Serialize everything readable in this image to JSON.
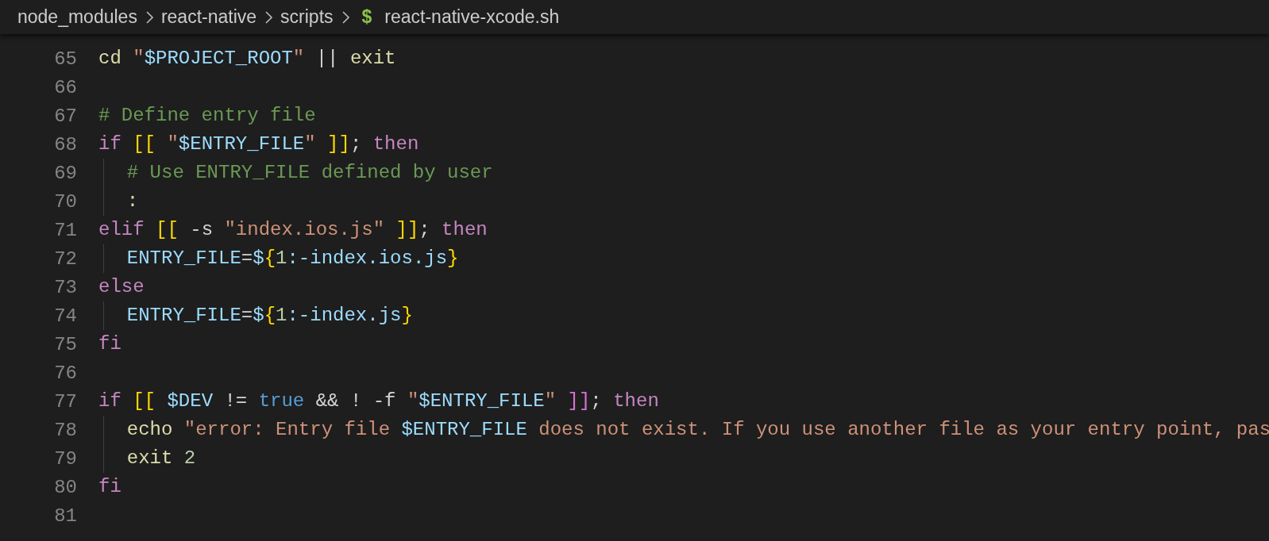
{
  "breadcrumb": [
    {
      "label": "node_modules"
    },
    {
      "label": "react-native"
    },
    {
      "label": "scripts"
    },
    {
      "label": "react-native-xcode.sh",
      "icon": "$"
    }
  ],
  "lines": [
    {
      "number": "65",
      "tokens": [
        {
          "kind": "command",
          "text": "cd"
        },
        {
          "kind": "string",
          "text": " \""
        },
        {
          "kind": "variable",
          "text": "$PROJECT_ROOT"
        },
        {
          "kind": "string",
          "text": "\""
        },
        {
          "kind": "plain",
          "text": " || "
        },
        {
          "kind": "command",
          "text": "exit"
        }
      ]
    },
    {
      "number": "66"
    },
    {
      "number": "67",
      "tokens": [
        {
          "kind": "comment",
          "text": "# Define entry file"
        }
      ]
    },
    {
      "number": "68",
      "tokens": [
        {
          "kind": "keyword",
          "text": "if"
        },
        {
          "kind": "bracket1",
          "text": " [["
        },
        {
          "kind": "string",
          "text": " \""
        },
        {
          "kind": "variable",
          "text": "$ENTRY_FILE"
        },
        {
          "kind": "string",
          "text": "\""
        },
        {
          "kind": "bracket1",
          "text": " ]]"
        },
        {
          "kind": "plain",
          "text": "; "
        },
        {
          "kind": "keyword",
          "text": "then"
        }
      ]
    },
    {
      "number": "69",
      "indented": true,
      "tokens": [
        {
          "kind": "comment",
          "text": "# Use ENTRY_FILE defined by user"
        }
      ]
    },
    {
      "number": "70",
      "indented": true,
      "tokens": [
        {
          "kind": "command",
          "text": ":"
        }
      ]
    },
    {
      "number": "71",
      "tokens": [
        {
          "kind": "keyword",
          "text": "elif"
        },
        {
          "kind": "bracket1",
          "text": " [["
        },
        {
          "kind": "plain",
          "text": " -s "
        },
        {
          "kind": "string",
          "text": "\"index.ios.js\""
        },
        {
          "kind": "bracket1",
          "text": " ]]"
        },
        {
          "kind": "plain",
          "text": "; "
        },
        {
          "kind": "keyword",
          "text": "then"
        }
      ]
    },
    {
      "number": "72",
      "indented": true,
      "tokens": [
        {
          "kind": "variable",
          "text": "ENTRY_FILE"
        },
        {
          "kind": "plain",
          "text": "="
        },
        {
          "kind": "variable",
          "text": "$"
        },
        {
          "kind": "bracket1",
          "text": "{"
        },
        {
          "kind": "number",
          "text": "1"
        },
        {
          "kind": "variable",
          "text": ":-index.ios.js"
        },
        {
          "kind": "bracket1",
          "text": "}"
        }
      ]
    },
    {
      "number": "73",
      "tokens": [
        {
          "kind": "keyword",
          "text": "else"
        }
      ]
    },
    {
      "number": "74",
      "indented": true,
      "tokens": [
        {
          "kind": "variable",
          "text": "ENTRY_FILE"
        },
        {
          "kind": "plain",
          "text": "="
        },
        {
          "kind": "variable",
          "text": "$"
        },
        {
          "kind": "bracket1",
          "text": "{"
        },
        {
          "kind": "number",
          "text": "1"
        },
        {
          "kind": "variable",
          "text": ":-index.js"
        },
        {
          "kind": "bracket1",
          "text": "}"
        }
      ]
    },
    {
      "number": "75",
      "tokens": [
        {
          "kind": "keyword",
          "text": "fi"
        }
      ]
    },
    {
      "number": "76"
    },
    {
      "number": "77",
      "tokens": [
        {
          "kind": "keyword",
          "text": "if"
        },
        {
          "kind": "bracket1",
          "text": " [["
        },
        {
          "kind": "variable",
          "text": " $DEV"
        },
        {
          "kind": "plain",
          "text": " != "
        },
        {
          "kind": "constant",
          "text": "true"
        },
        {
          "kind": "plain",
          "text": " && ! -f "
        },
        {
          "kind": "string",
          "text": "\""
        },
        {
          "kind": "variable",
          "text": "$ENTRY_FILE"
        },
        {
          "kind": "string",
          "text": "\""
        },
        {
          "kind": "bracket2",
          "text": " ]]"
        },
        {
          "kind": "plain",
          "text": "; "
        },
        {
          "kind": "keyword",
          "text": "then"
        }
      ]
    },
    {
      "number": "78",
      "indented": true,
      "tokens": [
        {
          "kind": "command",
          "text": "echo"
        },
        {
          "kind": "string",
          "text": " \"error: Entry file "
        },
        {
          "kind": "variable",
          "text": "$ENTRY_FILE"
        },
        {
          "kind": "string",
          "text": " does not exist. If you use another file as your entry point, pas"
        }
      ]
    },
    {
      "number": "79",
      "indented": true,
      "tokens": [
        {
          "kind": "command",
          "text": "exit"
        },
        {
          "kind": "number",
          "text": " 2"
        }
      ]
    },
    {
      "number": "80",
      "tokens": [
        {
          "kind": "keyword",
          "text": "fi"
        }
      ]
    },
    {
      "number": "81"
    }
  ]
}
